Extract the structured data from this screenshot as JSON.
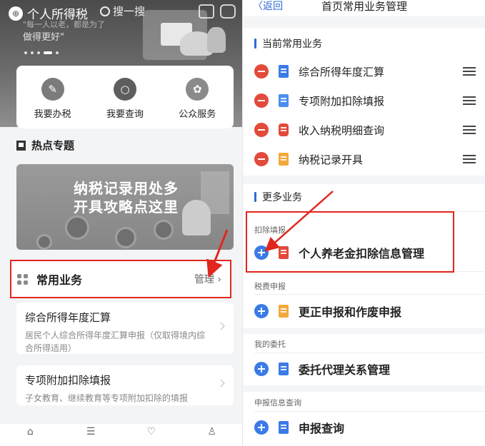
{
  "left": {
    "app_title": "个人所得税",
    "search_label": "搜一搜",
    "hero_sub1": "\"每一人以老，都是为了",
    "hero_sub2": "做得更好\"",
    "services": [
      {
        "label": "我要办税",
        "icon": "pen-icon",
        "color": "#7b7b7b"
      },
      {
        "label": "我要查询",
        "icon": "magnifier-icon",
        "color": "#5e5e5e"
      },
      {
        "label": "公众服务",
        "icon": "hand-flower-icon",
        "color": "#8a8a8a"
      }
    ],
    "hot_title": "热点专题",
    "banner": {
      "line1": "纳税记录用处多",
      "line2": "开具攻略点这里"
    },
    "common": {
      "title": "常用业务",
      "manage_label": "管理"
    },
    "biz_cards": [
      {
        "title": "综合所得年度汇算",
        "desc": "居民个人综合所得年度汇算申报（仅取得境内综合所得适用）"
      },
      {
        "title": "专项附加扣除填报",
        "desc": "子女教育、继续教育等专项附加扣除的填报"
      }
    ],
    "tabbar_icons": [
      "home-icon",
      "list-icon",
      "heart-icon",
      "user-icon"
    ]
  },
  "right": {
    "nav": {
      "back_label": "〈返回",
      "title": "首页常用业务管理"
    },
    "current_section": "当前常用业务",
    "current_items": [
      {
        "label": "综合所得年度汇算",
        "icon_color": "#3b7be8"
      },
      {
        "label": "专项附加扣除填报",
        "icon_color": "#4a8ef0"
      },
      {
        "label": "收入纳税明细查询",
        "icon_color": "#e24a3b"
      },
      {
        "label": "纳税记录开具",
        "icon_color": "#f2a93b"
      }
    ],
    "more_section": "更多业务",
    "groups": [
      {
        "category": "扣除填报",
        "item": "个人养老金扣除信息管理",
        "icon_color": "#e24a3b"
      },
      {
        "category": "税费申报",
        "item": "更正申报和作废申报",
        "icon_color": "#f2a93b"
      },
      {
        "category": "我的委托",
        "item": "委托代理关系管理",
        "icon_color": "#3b7be8"
      },
      {
        "category": "申报信息查询",
        "item": "申报查询",
        "icon_color": "#3b7be8"
      }
    ]
  },
  "colors": {
    "accent_blue": "#2f6bd8",
    "highlight_red": "#e0261d"
  }
}
